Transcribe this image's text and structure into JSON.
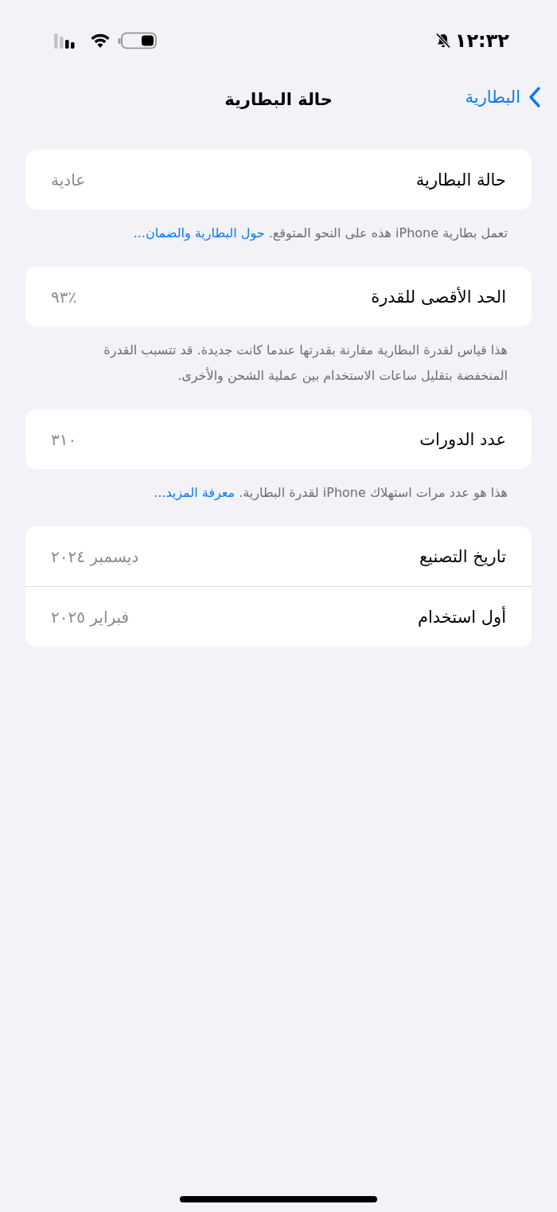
{
  "status_bar": {
    "time": "١٢:٣٢",
    "silent": true
  },
  "nav": {
    "back": "البطارية",
    "title": "حالة البطارية"
  },
  "sections": [
    {
      "rows": [
        {
          "label": "حالة البطارية",
          "value": "عادية"
        }
      ],
      "footer": {
        "text": "تعمل بطارية iPhone هذه على النحو المتوقع.",
        "link": "حول البطارية والضمان..."
      }
    },
    {
      "rows": [
        {
          "label": "الحد الأقصى للقدرة",
          "value": "٪٩٣"
        }
      ],
      "footer": {
        "text": "هذا قياس لقدرة البطارية مقارنة بقدرتها عندما كانت جديدة. قد تتسبب القدرة المنخفضة بتقليل ساعات الاستخدام بين عملية الشحن والأخرى."
      }
    },
    {
      "rows": [
        {
          "label": "عدد الدورات",
          "value": "٣١٠"
        }
      ],
      "footer": {
        "text": "هذا هو عدد مرات استهلاك iPhone لقدرة البطارية.",
        "link": "معرفة المزيد..."
      }
    },
    {
      "rows": [
        {
          "label": "تاريخ التصنيع",
          "value": "ديسمبر ٢٠٢٤"
        },
        {
          "label": "أول استخدام",
          "value": "فبراير ٢٠٢٥"
        }
      ]
    }
  ]
}
